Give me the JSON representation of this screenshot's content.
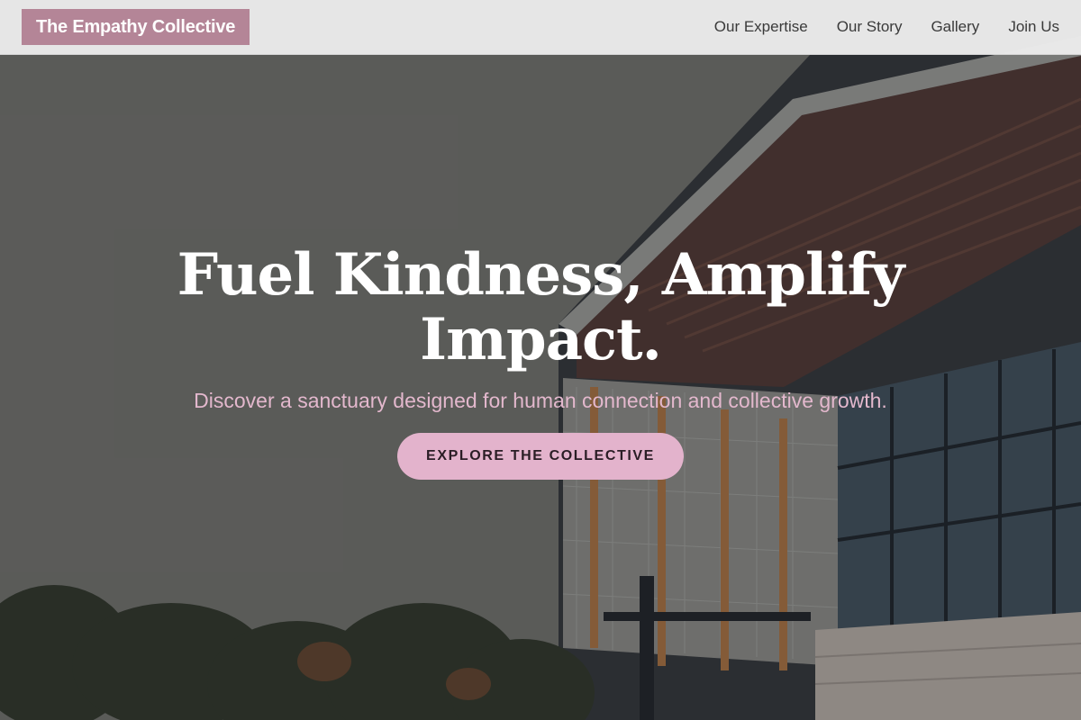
{
  "header": {
    "brand": "The Empathy Collective",
    "nav": [
      {
        "label": "Our Expertise"
      },
      {
        "label": "Our Story"
      },
      {
        "label": "Gallery"
      },
      {
        "label": "Join Us"
      }
    ]
  },
  "hero": {
    "title": "Fuel Kindness, Amplify Impact.",
    "subtitle": "Discover a sanctuary designed for human connection and collective growth.",
    "cta_label": "EXPLORE THE COLLECTIVE",
    "background_image": "modern-building-photo"
  },
  "colors": {
    "brand_bg": "#b48597",
    "cta_bg": "#e3b3cc",
    "subtitle": "#e3b8cd",
    "header_bg": "#ececec"
  }
}
